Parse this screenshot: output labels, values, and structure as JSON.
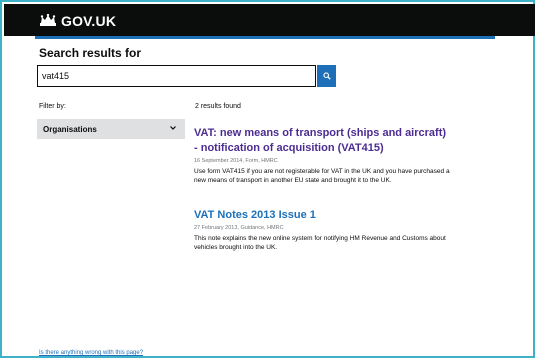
{
  "header": {
    "logo_text": "GOV.UK",
    "background_color": "#0b0c0c",
    "accent_color": "#1d70b8"
  },
  "page": {
    "title": "Search results for"
  },
  "search": {
    "value": "vat415",
    "button_icon": "search-icon"
  },
  "filter": {
    "label": "Filter by:",
    "selected": "Organisations",
    "icon": "chevron-down-icon"
  },
  "results": {
    "count_text": "2 results found",
    "items": [
      {
        "title_line1": "VAT: new means of transport (ships and aircraft)",
        "title_line2": "- notification of acquisition (VAT415)",
        "meta": "16 September 2014,  Form,  HMRC",
        "description": "Use form VAT415 if you are not registerable for VAT in the UK and you have purchased a new means of transport in another EU state and brought it to the UK."
      },
      {
        "title_line1": "VAT Notes 2013 Issue 1",
        "meta": "27 February 2013,  Guidance,  HMRC",
        "description": "This note explains the new online system for notifying HM Revenue and Customs about vehicles brought into the UK."
      }
    ]
  },
  "footer": {
    "link_text": "Is there anything wrong with this page?"
  }
}
